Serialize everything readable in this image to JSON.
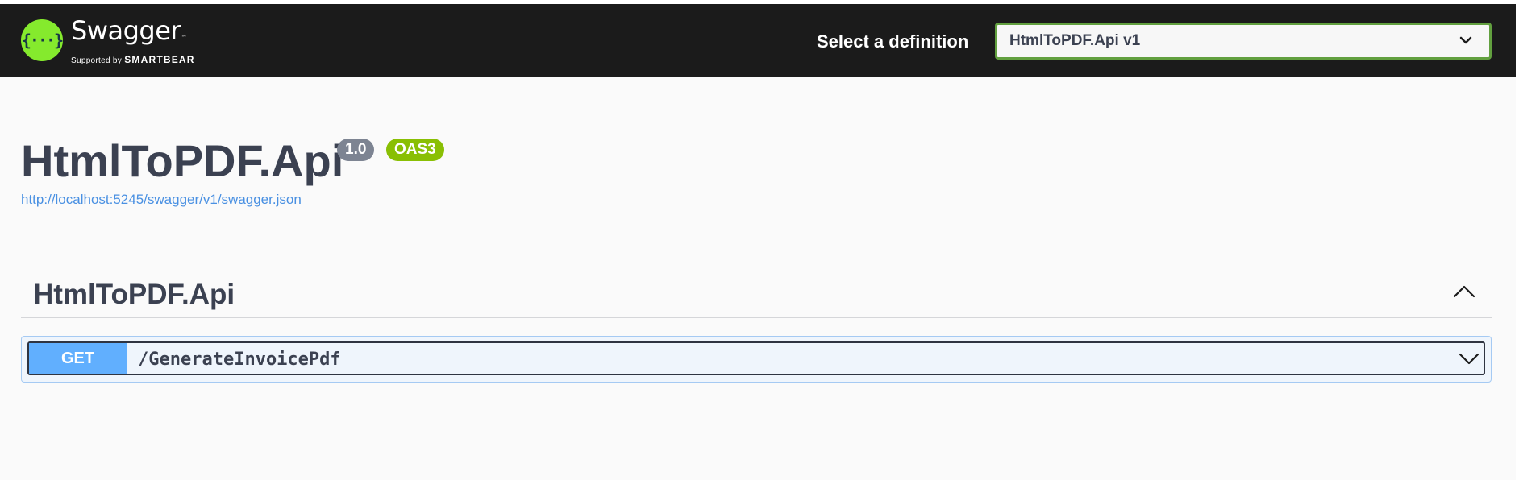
{
  "topbar": {
    "logo": {
      "name": "Swagger",
      "trademark": "™",
      "supported_by": "Supported by",
      "brand": "SMARTBEAR",
      "icon": "swagger-braces-icon"
    },
    "definition_label": "Select a definition",
    "definition_selected": "HtmlToPDF.Api v1"
  },
  "info": {
    "title": "HtmlToPDF.Api",
    "version_badge": "1.0",
    "oas_badge": "OAS3",
    "spec_url": "http://localhost:5245/swagger/v1/swagger.json"
  },
  "tag": {
    "name": "HtmlToPDF.Api",
    "toggle_icon": "chevron-up-icon"
  },
  "operations": [
    {
      "method": "GET",
      "path": "/GenerateInvoicePdf",
      "expand_icon": "chevron-down-icon"
    }
  ],
  "colors": {
    "topbar_bg": "#1b1b1b",
    "logo_green": "#85ea2d",
    "select_border": "#62a03f",
    "title_text": "#3b4151",
    "version_badge": "#7d8492",
    "oas_badge": "#89bf04",
    "link": "#4990e2",
    "get_method": "#61affe",
    "get_block_bg": "#eff5fc",
    "get_block_border": "#a5caf3"
  }
}
